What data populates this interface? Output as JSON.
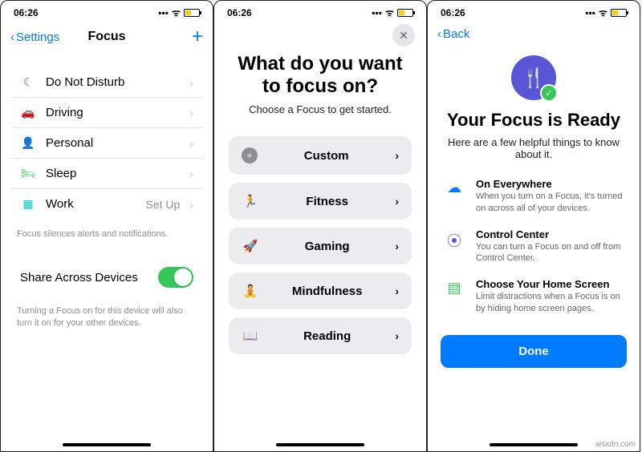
{
  "status": {
    "time": "06:26",
    "signal": "▪▪▪",
    "wifi": "᯾"
  },
  "p1": {
    "back": "Settings",
    "title": "Focus",
    "items": [
      {
        "icon": "☾",
        "label": "Do Not Disturb",
        "cls": "i-moon"
      },
      {
        "icon": "🚗",
        "label": "Driving",
        "cls": "i-car"
      },
      {
        "icon": "👤",
        "label": "Personal",
        "cls": "i-person"
      },
      {
        "icon": "🛏",
        "label": "Sleep",
        "cls": "i-bed"
      },
      {
        "icon": "▦",
        "label": "Work",
        "detail": "Set Up",
        "cls": "i-work"
      }
    ],
    "footer1": "Focus silences alerts and notifications.",
    "share_label": "Share Across Devices",
    "footer2": "Turning a Focus on for this device will also turn it on for your other devices."
  },
  "p2": {
    "title": "What do you want to focus on?",
    "sub": "Choose a Focus to get started.",
    "opts": [
      {
        "icon": "+",
        "label": "Custom",
        "cls": "i-plus"
      },
      {
        "icon": "🏃",
        "label": "Fitness",
        "cls": "i-fit"
      },
      {
        "icon": "🚀",
        "label": "Gaming",
        "cls": "i-game"
      },
      {
        "icon": "🧘",
        "label": "Mindfulness",
        "cls": "i-mind"
      },
      {
        "icon": "📖",
        "label": "Reading",
        "cls": "i-read"
      }
    ]
  },
  "p3": {
    "back": "Back",
    "hero": "🍴",
    "title": "Your Focus is Ready",
    "sub": "Here are a few helpful things to know about it.",
    "tips": [
      {
        "icon": "☁",
        "cls": "t1",
        "title": "On Everywhere",
        "body": "When you turn on a Focus, it's turned on across all of your devices."
      },
      {
        "icon": "⦿",
        "cls": "t2",
        "title": "Control Center",
        "body": "You can turn a Focus on and off from Control Center."
      },
      {
        "icon": "▤",
        "cls": "t3",
        "title": "Choose Your Home Screen",
        "body": "Limit distractions when a Focus is on by hiding home screen pages."
      }
    ],
    "done": "Done"
  },
  "watermark": "wsxdn.com"
}
